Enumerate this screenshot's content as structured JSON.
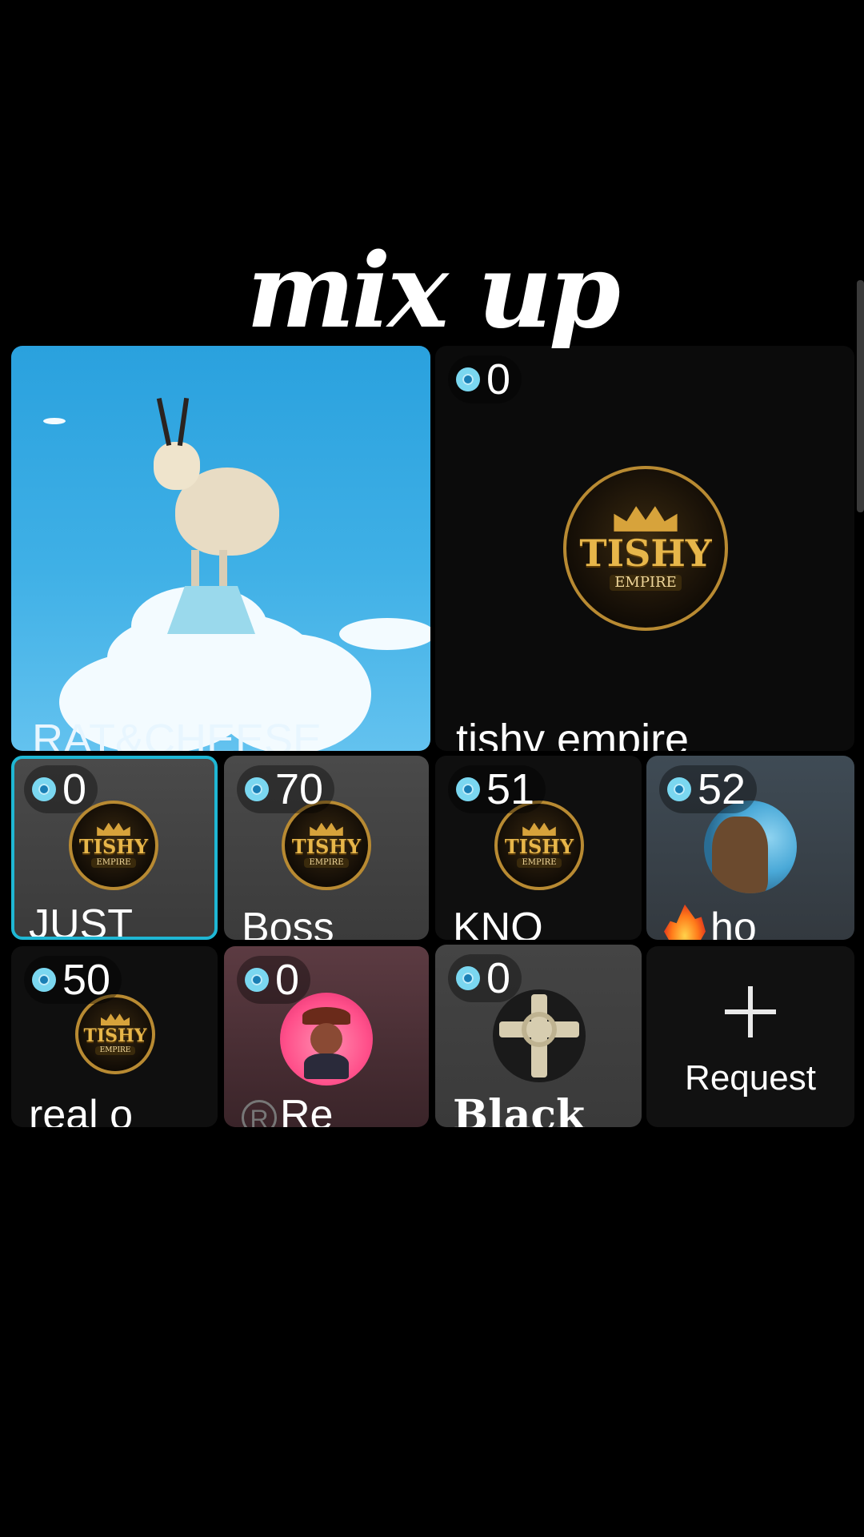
{
  "header": {
    "title": "mix up"
  },
  "host": {
    "name": "RAT&CHEESE"
  },
  "cohost": {
    "score": "0",
    "name": "tishy empire",
    "emblem_main": "TISHY",
    "emblem_sub": "EMPIRE"
  },
  "guests": [
    {
      "score": "0",
      "name": "JUST",
      "avatar": "tishy-emblem"
    },
    {
      "score": "70",
      "name": "Boss",
      "avatar": "tishy-emblem"
    },
    {
      "score": "51",
      "name": "KNO",
      "avatar": "tishy-emblem"
    },
    {
      "score": "52",
      "name": "ho",
      "avatar": "photo"
    },
    {
      "score": "50",
      "name": "real o",
      "avatar": "tishy-emblem"
    },
    {
      "score": "0",
      "name": "Re",
      "avatar": "cartoon"
    },
    {
      "score": "0",
      "name": "Black",
      "avatar": "cross"
    }
  ],
  "emblem_text": {
    "main": "TISHY",
    "sub": "EMPIRE"
  },
  "request": {
    "label": "Request"
  },
  "colors": {
    "selected_border": "#1fb7d4",
    "score_icon": "#7ad7f0",
    "sky": "#2aa1de"
  }
}
